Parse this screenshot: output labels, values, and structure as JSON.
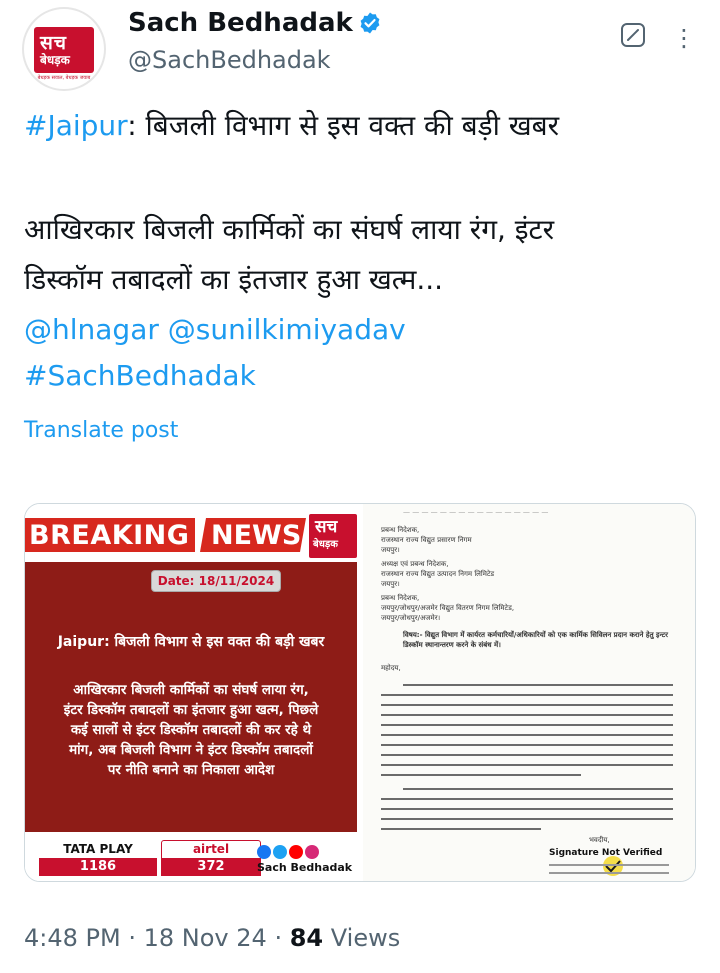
{
  "author": {
    "name": "Sach Bedhadak",
    "handle": "@SachBedhadak",
    "logo_line1": "सच",
    "logo_line2": "बेधड़क",
    "logo_tagline": "बेधड़क सवाल, बेधड़क जवाब"
  },
  "post": {
    "line1_tag": "#Jaipur",
    "line1_text": ": बिजली विभाग से इस वक्त की बड़ी खबर",
    "line2": "आखिरकार बिजली कार्मिकों का संघर्ष लाया रंग, इंटर",
    "line3": "डिस्कॉम तबादलों का इंतजार हुआ खत्म...",
    "mention1": "@hlnagar",
    "mention2": "@sunilkimiyadav",
    "hashtag": "#SachBedhadak",
    "translate": "Translate post"
  },
  "image1": {
    "breaking": "BREAKING",
    "news": "NEWS",
    "logo_line1": "सच",
    "logo_line2": "बेधड़क",
    "date": "Date: 18/11/2024",
    "headline": "Jaipur: बिजली विभाग से इस वक्त की बड़ी खबर",
    "body": [
      "आखिरकार बिजली कार्मिकों का संघर्ष लाया रंग,",
      "इंटर डिस्कॉम तबादलों का इंतजार हुआ खत्म, पिछले",
      "कई सालों से इंटर डिस्कॉम तबादलों की कर रहे थे",
      "मांग, अब बिजली विभाग ने इंटर डिस्कॉम तबादलों",
      "पर नीति बनाने का निकाला आदेश"
    ],
    "tataplay": "TATA PLAY",
    "tataplay_channel": "1186",
    "airtel": "airtel",
    "airtel_channel": "372",
    "footer_name": "Sach Bedhadak"
  },
  "image2": {
    "addressees": [
      "प्रबन्ध निदेशक,",
      "राजस्थान राज्य विद्युत प्रसारण निगम",
      "जयपुर।",
      "अध्यक्ष एवं प्रबन्ध निदेशक,",
      "राजस्थान राज्य विद्युत उत्पादन निगम लिमिटेड",
      "जयपुर।",
      "प्रबन्ध निदेशक,",
      "जयपुर/जोधपुर/अजमेर विद्युत वितरण निगम लिमिटेड,",
      "जयपुर/जोधपुर/अजमेर।"
    ],
    "subject": "विषय:- विद्युत विभाग में कार्यरत कर्मचारियों/अधिकारियों को एक कार्मिक सिविलन प्रदान कराने हेतु इन्टर डिस्कॉम स्थानान्तरण करने के संबंध में।",
    "salutation": "महोदय,",
    "signature_label": "Signature Not Verified",
    "signoff": "भवदीय,"
  },
  "meta": {
    "time": "4:48 PM",
    "sep1": "·",
    "date": "18 Nov 24",
    "sep2": "·",
    "views_count": "84",
    "views_label": "Views"
  },
  "colors": {
    "link": "#1d9bf0",
    "secondary_text": "#536471",
    "brand_red": "#c8102e",
    "panel_red": "#8e1c17"
  }
}
